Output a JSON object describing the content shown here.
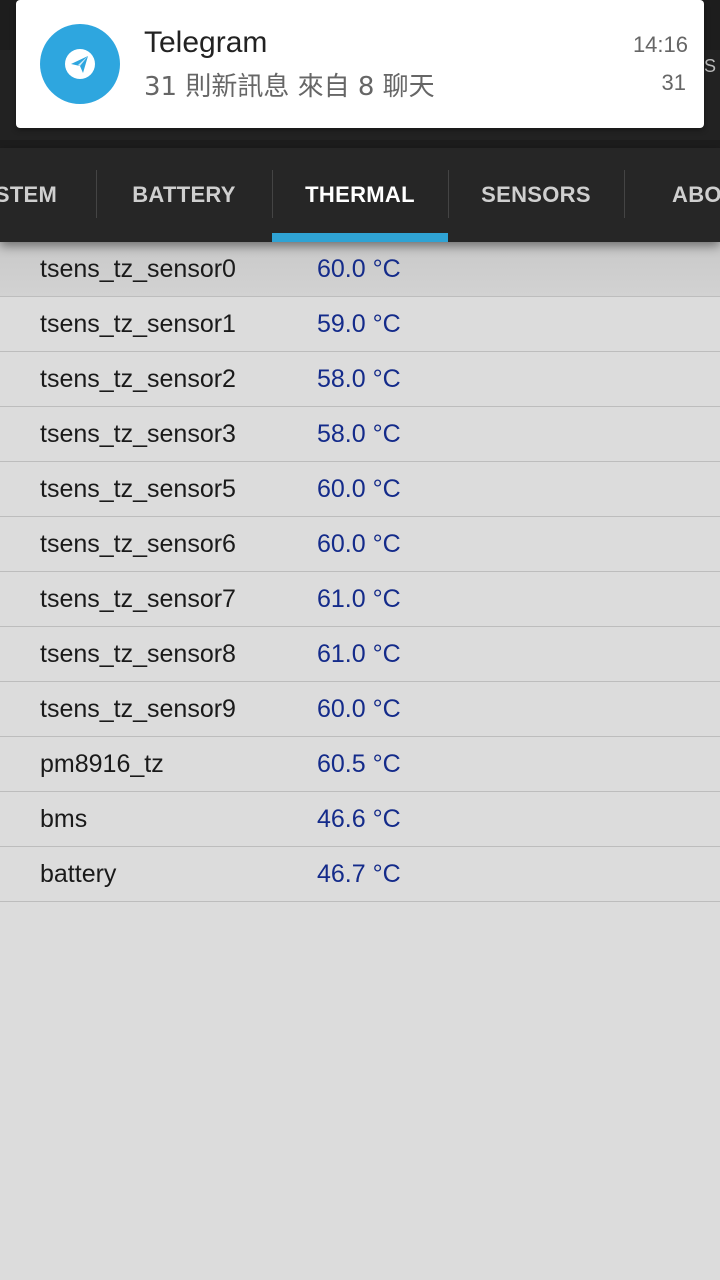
{
  "notification": {
    "app_name": "Telegram",
    "message": "31 則新訊息 來自 8 聊天",
    "time": "14:16",
    "count": "31",
    "icon": "paper-plane-icon",
    "accent": "#2ea6df"
  },
  "header_peek": "S",
  "tabs": [
    {
      "label": "STEM",
      "active": false
    },
    {
      "label": "BATTERY",
      "active": false
    },
    {
      "label": "THERMAL",
      "active": true
    },
    {
      "label": "SENSORS",
      "active": false
    },
    {
      "label": "ABO",
      "active": false
    }
  ],
  "thermal": [
    {
      "name": "tsens_tz_sensor0",
      "value": "60.0 °C"
    },
    {
      "name": "tsens_tz_sensor1",
      "value": "59.0 °C"
    },
    {
      "name": "tsens_tz_sensor2",
      "value": "58.0 °C"
    },
    {
      "name": "tsens_tz_sensor3",
      "value": "58.0 °C"
    },
    {
      "name": "tsens_tz_sensor5",
      "value": "60.0 °C"
    },
    {
      "name": "tsens_tz_sensor6",
      "value": "60.0 °C"
    },
    {
      "name": "tsens_tz_sensor7",
      "value": "61.0 °C"
    },
    {
      "name": "tsens_tz_sensor8",
      "value": "61.0 °C"
    },
    {
      "name": "tsens_tz_sensor9",
      "value": "60.0 °C"
    },
    {
      "name": "pm8916_tz",
      "value": "60.5 °C"
    },
    {
      "name": "bms",
      "value": "46.6 °C"
    },
    {
      "name": "battery",
      "value": "46.7 °C"
    }
  ],
  "colors": {
    "tab_indicator": "#2fa3d4",
    "value_text": "#142b8a"
  }
}
